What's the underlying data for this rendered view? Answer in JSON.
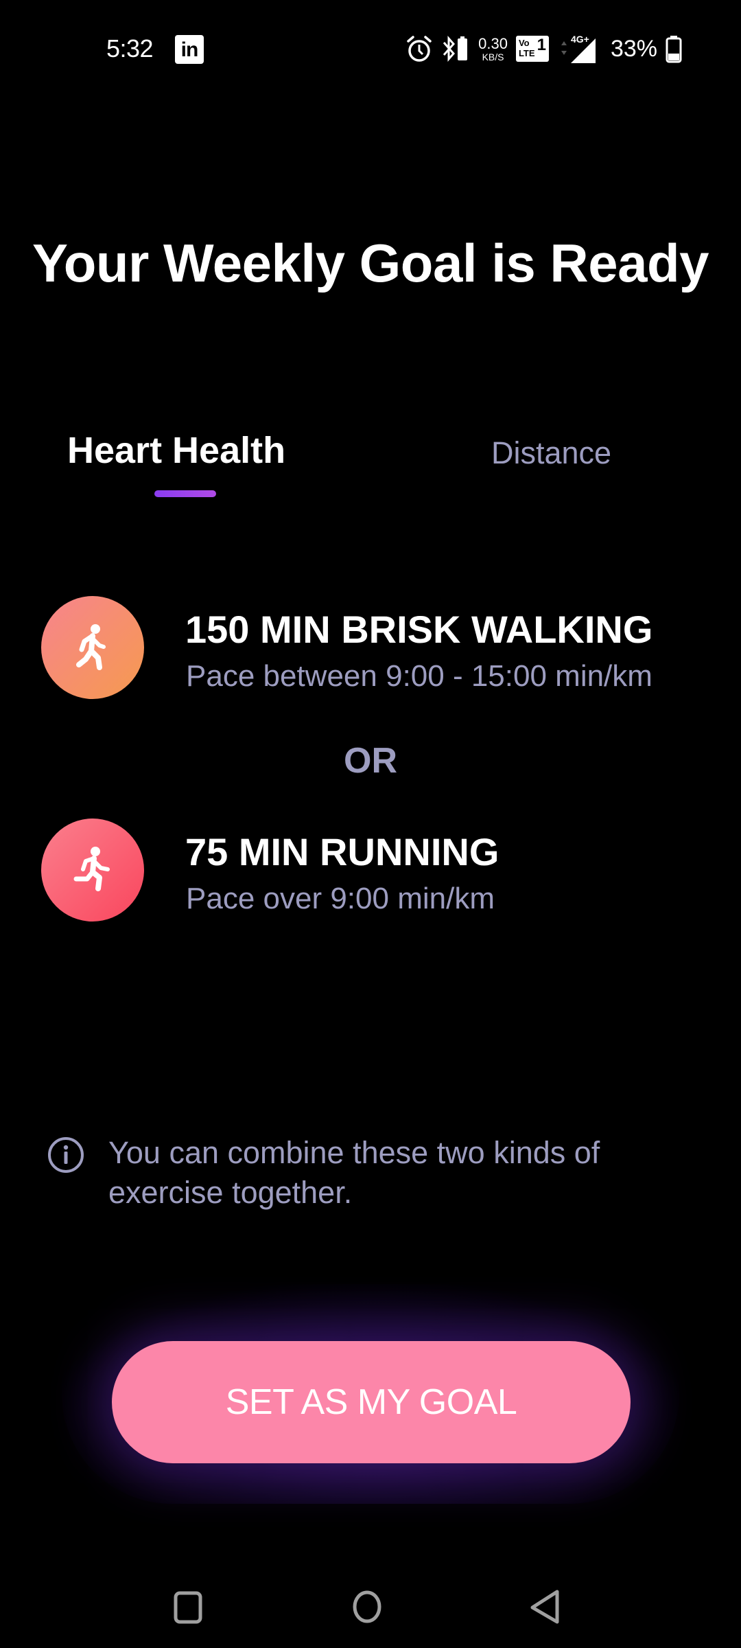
{
  "status_bar": {
    "time": "5:32",
    "notification_app": "in",
    "network_speed_value": "0.30",
    "network_speed_unit": "KB/S",
    "volte_label_top": "Vo",
    "volte_label_bottom": "LTE",
    "sim_slot": "1",
    "network_type": "4G+",
    "battery_percent": "33%",
    "icons": [
      "linkedin-icon",
      "alarm-icon",
      "bluetooth-battery-icon",
      "volte-icon",
      "signal-icon",
      "battery-icon"
    ]
  },
  "header": {
    "title": "Your Weekly Goal is Ready"
  },
  "tabs": [
    {
      "label": "Heart Health",
      "active": true
    },
    {
      "label": "Distance",
      "active": false
    }
  ],
  "goals": [
    {
      "icon": "walking-icon",
      "title": "150 MIN BRISK WALKING",
      "subtitle": "Pace between 9:00 - 15:00 min/km",
      "gradient": [
        "#f7848d",
        "#f59a4f"
      ]
    },
    {
      "icon": "running-icon",
      "title": "75 MIN RUNNING",
      "subtitle": "Pace over 9:00 min/km",
      "gradient": [
        "#fb7f8d",
        "#f9465d"
      ]
    }
  ],
  "separator": "OR",
  "info": {
    "icon": "info-icon",
    "text": "You can combine these two kinds of exercise together."
  },
  "cta": {
    "label": "SET AS MY GOAL",
    "color": "#fc86a9"
  },
  "colors": {
    "background": "#000000",
    "secondary_text": "#9d9dc0",
    "tab_indicator": "#9b44ec"
  },
  "nav_bar": {
    "buttons": [
      "recents",
      "home",
      "back"
    ]
  }
}
